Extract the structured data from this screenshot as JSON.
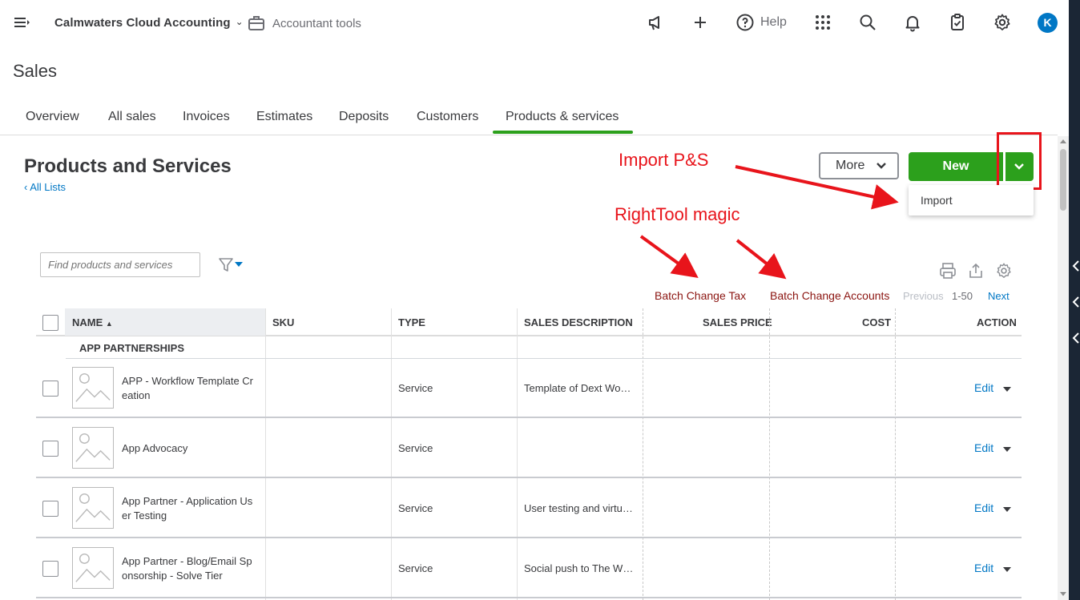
{
  "topbar": {
    "company_name": "Calmwaters Cloud Accounting",
    "accountant_tools": "Accountant tools",
    "help_label": "Help",
    "avatar_initial": "K"
  },
  "page": {
    "title": "Sales",
    "tabs": [
      "Overview",
      "All sales",
      "Invoices",
      "Estimates",
      "Deposits",
      "Customers",
      "Products & services"
    ],
    "active_tab": "Products & services"
  },
  "main": {
    "heading": "Products and Services",
    "all_lists": "All Lists",
    "more_label": "More",
    "new_label": "New",
    "dropdown_item": "Import",
    "search_placeholder": "Find products and services",
    "batch_tax": "Batch Change Tax",
    "batch_accounts": "Batch Change Accounts",
    "pager": {
      "previous": "Previous",
      "range": "1-50",
      "next": "Next"
    }
  },
  "annotations": {
    "import_label": "Import P&S",
    "righttool_label": "RightTool magic",
    "color": "#e8141b"
  },
  "table": {
    "headers": [
      "NAME",
      "SKU",
      "TYPE",
      "SALES DESCRIPTION",
      "SALES PRICE",
      "COST",
      "ACTION"
    ],
    "group": "APP PARTNERSHIPS",
    "rows": [
      {
        "name": [
          "APP - Workflow Template Cr",
          "eation"
        ],
        "sku": "",
        "type": "Service",
        "description": "Template of Dext Wo…",
        "price": "",
        "cost": "",
        "action": "Edit"
      },
      {
        "name": [
          "App Advocacy"
        ],
        "sku": "",
        "type": "Service",
        "description": "",
        "price": "",
        "cost": "",
        "action": "Edit"
      },
      {
        "name": [
          "App Partner - Application Us",
          "er Testing"
        ],
        "sku": "",
        "type": "Service",
        "description": "User testing and virtu…",
        "price": "",
        "cost": "",
        "action": "Edit"
      },
      {
        "name": [
          "App Partner - Blog/Email Sp",
          "onsorship - Solve Tier"
        ],
        "sku": "",
        "type": "Service",
        "description": "Social push to The W…",
        "price": "",
        "cost": "",
        "action": "Edit"
      }
    ]
  },
  "colors": {
    "brand_green": "#2ca01c",
    "link_blue": "#0077c5",
    "batch_red": "#8b1410"
  }
}
